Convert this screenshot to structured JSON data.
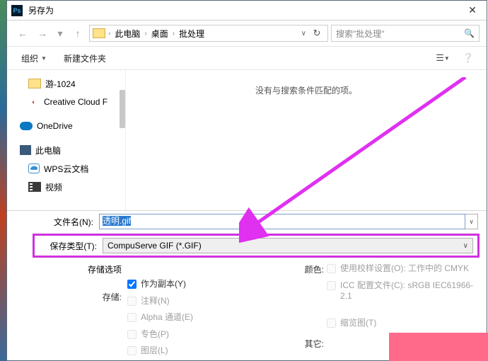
{
  "title": "另存为",
  "breadcrumbs": [
    "此电脑",
    "桌面",
    "批处理"
  ],
  "search_placeholder": "搜索\"批处理\"",
  "toolbar": {
    "organize": "组织",
    "new_folder": "新建文件夹"
  },
  "sidebar": {
    "items": [
      {
        "label": "游-1024",
        "icon": "folder"
      },
      {
        "label": "Creative Cloud F",
        "icon": "cc"
      },
      {
        "label": "OneDrive",
        "icon": "cloud"
      },
      {
        "label": "此电脑",
        "icon": "pc"
      },
      {
        "label": "WPS云文档",
        "icon": "wps"
      },
      {
        "label": "视频",
        "icon": "video"
      }
    ]
  },
  "empty_message": "没有与搜索条件匹配的项。",
  "filename_label": "文件名(N):",
  "filename_value": "透明.gif",
  "filetype_label": "保存类型(T):",
  "filetype_value": "CompuServe GIF (*.GIF)",
  "options": {
    "header": "存储选项",
    "store_label": "存储:",
    "as_copy": "作为副本(Y)",
    "notes": "注释(N)",
    "alpha": "Alpha 通道(E)",
    "spot": "专色(P)",
    "layers": "图层(L)",
    "color_label": "颜色:",
    "proof": "使用校样设置(O): 工作中的 CMYK",
    "icc": "ICC 配置文件(C): sRGB IEC61966-2.1",
    "other_label": "其它:",
    "thumbnail": "缩览图(T)"
  },
  "annotation_color": "#e030f0"
}
